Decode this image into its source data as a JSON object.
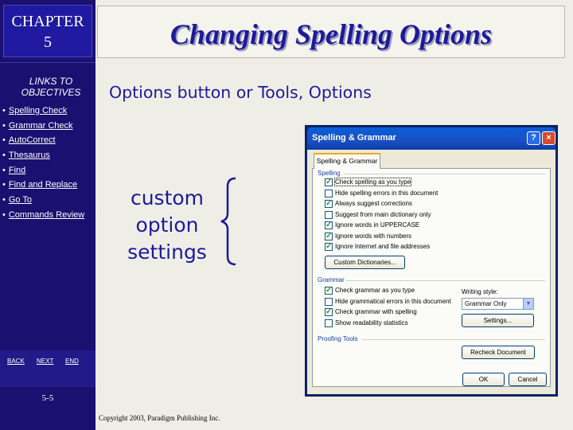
{
  "sidebar": {
    "chapter_line1": "CHAPTER",
    "chapter_line2": "5",
    "links_title_line1": "LINKS TO",
    "links_title_line2": "OBJECTIVES",
    "links": [
      {
        "label": "Spelling Check"
      },
      {
        "label": "Grammar Check"
      },
      {
        "label": "AutoCorrect"
      },
      {
        "label": "Thesaurus"
      },
      {
        "label": "Find"
      },
      {
        "label": "Find and Replace"
      },
      {
        "label": "Go To"
      },
      {
        "label": "Commands Review"
      }
    ],
    "back_label": "BACK",
    "next_label": "NEXT",
    "end_label": "END",
    "page_number": "5-5"
  },
  "slide": {
    "title": "Changing Spelling Options",
    "subtitle": "Options button or Tools, Options",
    "callout_line1": "custom",
    "callout_line2": "option",
    "callout_line3": "settings",
    "copyright": "Copyright 2003, Paradigm Publishing Inc."
  },
  "dialog": {
    "title": "Spelling & Grammar",
    "help_icon_glyph": "?",
    "close_icon_glyph": "×",
    "tab_label": "Spelling & Grammar",
    "spelling_group": "Spelling",
    "spelling_options": [
      {
        "label": "Check spelling as you type",
        "checked": true
      },
      {
        "label": "Hide spelling errors in this document",
        "checked": false
      },
      {
        "label": "Always suggest corrections",
        "checked": true
      },
      {
        "label": "Suggest from main dictionary only",
        "checked": false
      },
      {
        "label": "Ignore words in UPPERCASE",
        "checked": true
      },
      {
        "label": "Ignore words with numbers",
        "checked": true
      },
      {
        "label": "Ignore Internet and file addresses",
        "checked": true
      }
    ],
    "custom_dictionaries_button": "Custom Dictionaries...",
    "grammar_group": "Grammar",
    "grammar_options": [
      {
        "label": "Check grammar as you type",
        "checked": true
      },
      {
        "label": "Hide grammatical errors in this document",
        "checked": false
      },
      {
        "label": "Check grammar with spelling",
        "checked": true
      },
      {
        "label": "Show readability statistics",
        "checked": false
      }
    ],
    "writing_style_label": "Writing style:",
    "writing_style_value": "Grammar Only",
    "settings_button": "Settings...",
    "proofing_group": "Proofing Tools",
    "recheck_button": "Recheck Document",
    "ok_button": "OK",
    "cancel_button": "Cancel"
  },
  "colors": {
    "sidebar_background": "#1a1070",
    "title_text": "#1d1a9a",
    "dialog_titlebar": "#0a5ed8"
  }
}
